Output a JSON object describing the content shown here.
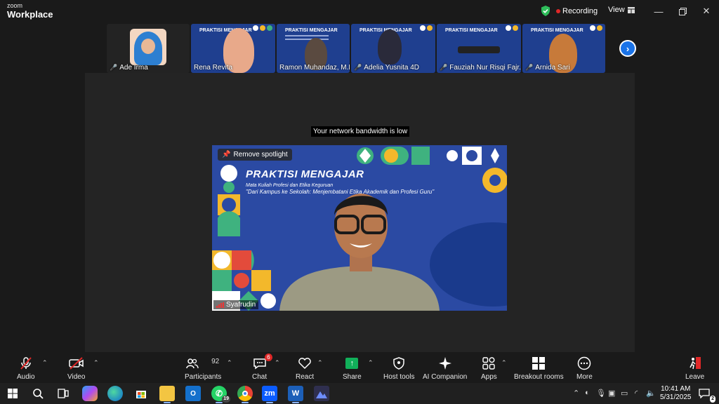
{
  "app": {
    "brand_top": "zoom",
    "brand_bottom": "Workplace"
  },
  "titlebar": {
    "recording_label": "Recording",
    "view_label": "View"
  },
  "participants_strip": [
    {
      "name": "Ade Irma",
      "muted": true
    },
    {
      "name": "Rena Revita",
      "muted": false
    },
    {
      "name": "Ramon Muhandaz, M.Pd.",
      "muted": false
    },
    {
      "name": "Adelia Yusnita 4D",
      "muted": true
    },
    {
      "name": "Fauziah Nur Risqi Fajr...",
      "muted": true
    },
    {
      "name": "Arnida Sari",
      "muted": true
    }
  ],
  "stage": {
    "bandwidth_notice": "Your network bandwidth is low",
    "remove_spotlight": "Remove spotlight",
    "slide_title": "PRAKTISI MENGAJAR",
    "slide_sub1": "Mata Kuliah Profesi dan Etika Keguruan",
    "slide_sub2": "\"Dari Kampus ke Sekolah: Menjembatani Etika Akademik dan Profesi Guru\"",
    "speaker_name": "Syafrudin"
  },
  "toolbar": {
    "audio": "Audio",
    "video": "Video",
    "participants": "Participants",
    "participants_count": "92",
    "chat": "Chat",
    "chat_badge": "6",
    "react": "React",
    "share": "Share",
    "host_tools": "Host tools",
    "ai_companion": "AI Companion",
    "apps": "Apps",
    "breakout": "Breakout rooms",
    "more": "More",
    "leave": "Leave"
  },
  "taskbar": {
    "whatsapp_badge": "19",
    "zoom_label": "zm",
    "time": "10:41 AM",
    "date": "5/31/2025",
    "notif_count": "2"
  },
  "colors": {
    "accent_blue": "#1a73e8",
    "record_red": "#e02828",
    "share_green": "#11b05a",
    "slide_blue": "#2b4aa3"
  }
}
